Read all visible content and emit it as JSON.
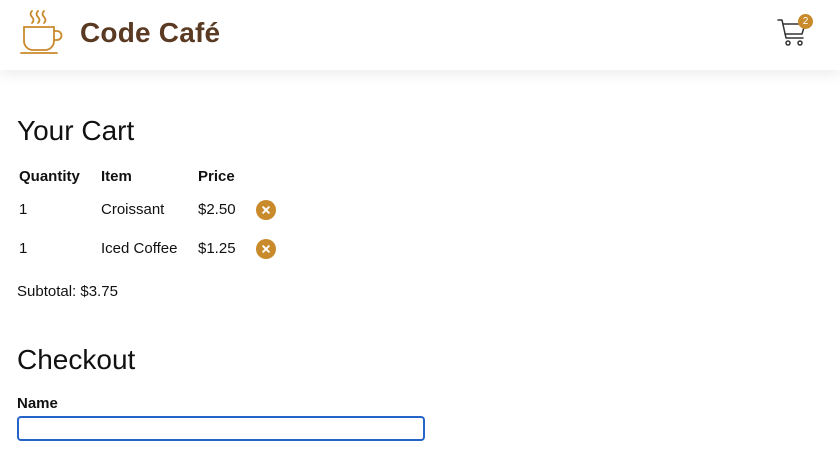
{
  "header": {
    "brand": "Code Café",
    "logo_icon": "coffee-cup-icon",
    "cart_icon": "shopping-cart-icon",
    "cart_count": "2",
    "accent_color": "#c98a2b",
    "brand_color": "#5a3a22"
  },
  "cart": {
    "title": "Your Cart",
    "columns": {
      "quantity": "Quantity",
      "item": "Item",
      "price": "Price"
    },
    "rows": [
      {
        "quantity": "1",
        "item": "Croissant",
        "price": "$2.50",
        "remove_icon": "close-circle-icon"
      },
      {
        "quantity": "1",
        "item": "Iced Coffee",
        "price": "$1.25",
        "remove_icon": "close-circle-icon"
      }
    ],
    "subtotal": "Subtotal: $3.75"
  },
  "checkout": {
    "title": "Checkout",
    "name_label": "Name",
    "name_value": "",
    "input_focus_color": "#2563c9"
  }
}
